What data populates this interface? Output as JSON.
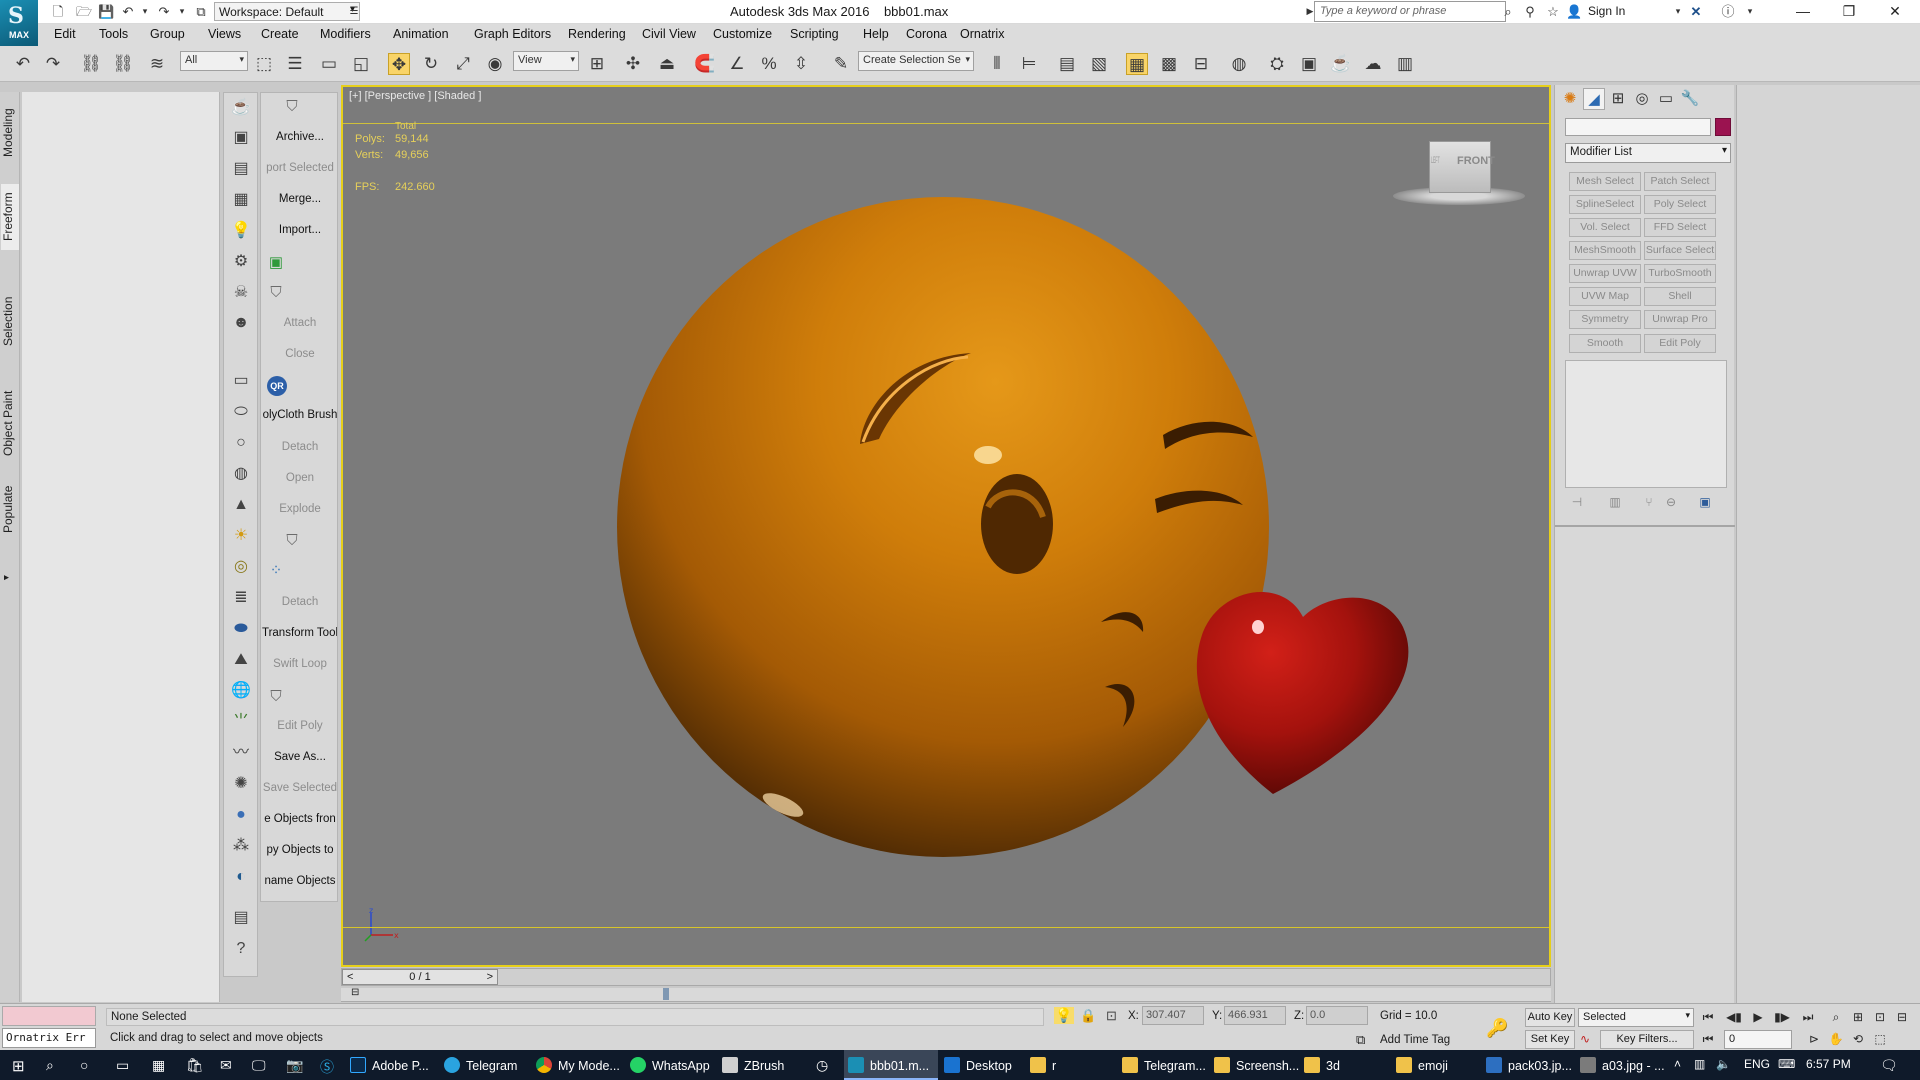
{
  "titlebar": {
    "workspace": "Workspace: Default",
    "app_title": "Autodesk 3ds Max 2016",
    "file_name": "bbb01.max",
    "search_placeholder": "Type a keyword or phrase",
    "sign_in": "Sign In",
    "logo_text": "MAX"
  },
  "menu": [
    "Edit",
    "Tools",
    "Group",
    "Views",
    "Create",
    "Modifiers",
    "Animation",
    "Graph Editors",
    "Rendering",
    "Civil View",
    "Customize",
    "Scripting",
    "Help",
    "Corona",
    "Ornatrix"
  ],
  "toolbar": {
    "selection_filter": "All",
    "reference_coord": "View",
    "named_selection": "Create Selection Se"
  },
  "ribbon_tabs": [
    "Modeling",
    "Freeform",
    "Selection",
    "Object Paint",
    "Populate"
  ],
  "function_panel": [
    {
      "label": "Archive...",
      "dim": false
    },
    {
      "label": "port Selected",
      "dim": true
    },
    {
      "label": "Merge...",
      "dim": false
    },
    {
      "label": "Import...",
      "dim": false
    },
    {
      "label": "Attach",
      "dim": true
    },
    {
      "label": "Close",
      "dim": true
    },
    {
      "label": "olyCloth Brush",
      "dim": false
    },
    {
      "label": "Detach",
      "dim": true
    },
    {
      "label": "Open",
      "dim": true
    },
    {
      "label": "Explode",
      "dim": true
    },
    {
      "label": "Detach",
      "dim": true
    },
    {
      "label": "Transform Tool",
      "dim": false
    },
    {
      "label": "Swift Loop",
      "dim": true
    },
    {
      "label": "Edit Poly",
      "dim": true
    },
    {
      "label": "Save As...",
      "dim": false
    },
    {
      "label": "Save Selected",
      "dim": true
    },
    {
      "label": "e Objects fron",
      "dim": false
    },
    {
      "label": "py Objects to",
      "dim": false
    },
    {
      "label": "name Objects",
      "dim": false
    }
  ],
  "viewport": {
    "label": "[+] [Perspective ] [Shaded ]",
    "stats_header": "Total",
    "polys_label": "Polys:",
    "polys": "59,144",
    "verts_label": "Verts:",
    "verts": "49,656",
    "fps_label": "FPS:",
    "fps": "242.660",
    "viewcube_face": "FRONT",
    "viewcube_side": "LEFT",
    "emoji_color": "#d47f0a",
    "heart_color": "#b3140f"
  },
  "timeline": {
    "frame_display": "0 / 1"
  },
  "command_panel": {
    "modifier_list": "Modifier List",
    "swatch_color": "#9b1350",
    "modifier_buttons": [
      [
        "Mesh Select",
        "Patch Select"
      ],
      [
        "SplineSelect",
        "Poly Select"
      ],
      [
        "Vol. Select",
        "FFD Select"
      ],
      [
        "MeshSmooth",
        "Surface Select"
      ],
      [
        "Unwrap UVW",
        "TurboSmooth"
      ],
      [
        "UVW Map",
        "Shell"
      ],
      [
        "Symmetry",
        "Unwrap Pro"
      ],
      [
        "Smooth",
        "Edit Poly"
      ]
    ]
  },
  "status": {
    "listener": "Ornatrix Err",
    "selection": "None Selected",
    "prompt": "Click and drag to select and move objects",
    "x_label": "X:",
    "x": "307.407",
    "y_label": "Y:",
    "y": "466.931",
    "z_label": "Z:",
    "z": "0.0",
    "grid": "Grid = 10.0",
    "add_time_tag": "Add Time Tag",
    "auto_key": "Auto Key",
    "set_key": "Set Key",
    "selected": "Selected",
    "key_filters": "Key Filters...",
    "frame": "0"
  },
  "taskbar": {
    "tasks": [
      "Adobe P...",
      "Telegram",
      "My Mode...",
      "WhatsApp",
      "ZBrush",
      "bbb01.m...",
      "Desktop",
      "r",
      "Telegram...",
      "Screensh...",
      "3d",
      "emoji",
      "pack03.jp...",
      "a03.jpg - ..."
    ],
    "lang": "ENG",
    "time": "6:57 PM"
  }
}
